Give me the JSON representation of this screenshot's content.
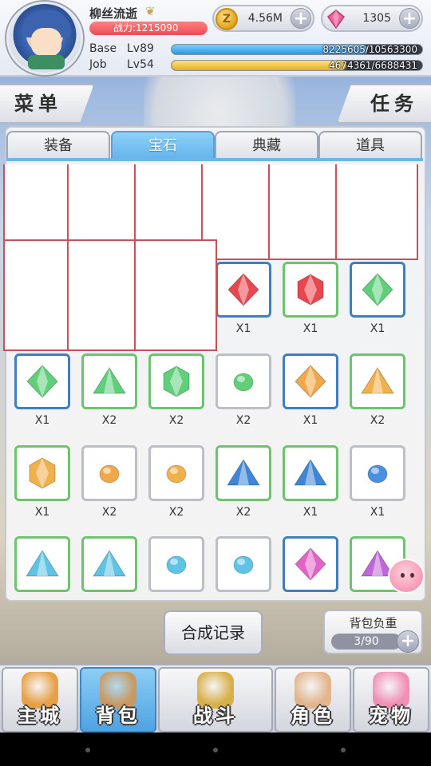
{
  "player": {
    "name": "柳丝流逝",
    "power": "战力:1215090",
    "base_label": "Base",
    "base_level": "Lv89",
    "base_exp": "8225605/10563300",
    "base_progress": 0.779,
    "job_label": "Job",
    "job_level": "Lv54",
    "job_exp": "4674361/6688431",
    "job_progress": 0.699
  },
  "currency": {
    "coin_value": "4.56M",
    "coin_glyph": "Z",
    "gem_value": "1305",
    "plus": "+"
  },
  "side_buttons": {
    "menu": "菜单",
    "task": "任务"
  },
  "tabs": [
    {
      "label": "装备",
      "active": false
    },
    {
      "label": "宝石",
      "active": true
    },
    {
      "label": "典藏",
      "active": false
    },
    {
      "label": "道具",
      "active": false
    }
  ],
  "inventory": {
    "rows": [
      [
        {
          "gem": "diamond",
          "color": "#e8474f",
          "border": "blue",
          "qty": "X1"
        },
        {
          "gem": "hexagon",
          "color": "#e8474f",
          "border": "green",
          "qty": "X1"
        },
        {
          "gem": "diamond",
          "color": "#5fcf7a",
          "border": "blue",
          "qty": "X1"
        }
      ],
      [
        {
          "gem": "diamond",
          "color": "#5fcf7a",
          "border": "blue",
          "qty": "X1"
        },
        {
          "gem": "triangle",
          "color": "#5fcf7a",
          "border": "green",
          "qty": "X2"
        },
        {
          "gem": "hexagon",
          "color": "#5fcf7a",
          "border": "green",
          "qty": "X2"
        },
        {
          "gem": "round",
          "color": "#5fcf7a",
          "border": "gray",
          "qty": "X2"
        },
        {
          "gem": "diamond",
          "color": "#f0a84a",
          "border": "blue",
          "qty": "X1"
        },
        {
          "gem": "triangle",
          "color": "#f0b04a",
          "border": "green",
          "qty": "X2"
        }
      ],
      [
        {
          "gem": "hexagon",
          "color": "#f0b04a",
          "border": "green",
          "qty": "X1"
        },
        {
          "gem": "round",
          "color": "#f0a84a",
          "border": "gray",
          "qty": "X2"
        },
        {
          "gem": "round",
          "color": "#f0b04a",
          "border": "gray",
          "qty": "X2"
        },
        {
          "gem": "triangle",
          "color": "#3f86d6",
          "border": "green",
          "qty": "X2"
        },
        {
          "gem": "triangle",
          "color": "#3f86d6",
          "border": "green",
          "qty": "X1"
        },
        {
          "gem": "round",
          "color": "#4a8fe0",
          "border": "gray",
          "qty": "X1"
        }
      ],
      [
        {
          "gem": "triangle",
          "color": "#5ec4e6",
          "border": "green",
          "qty": ""
        },
        {
          "gem": "triangle",
          "color": "#5ec4e6",
          "border": "green",
          "qty": ""
        },
        {
          "gem": "round",
          "color": "#5ec4e6",
          "border": "gray",
          "qty": ""
        },
        {
          "gem": "round",
          "color": "#5ec4e6",
          "border": "gray",
          "qty": ""
        },
        {
          "gem": "diamond",
          "color": "#e064c8",
          "border": "blue",
          "qty": ""
        },
        {
          "gem": "triangle",
          "color": "#c066d8",
          "border": "green",
          "qty": ""
        }
      ]
    ]
  },
  "synth_button": "合成记录",
  "bag": {
    "label": "背包负重",
    "count": "3/90"
  },
  "nav": [
    {
      "label": "主城",
      "active": false,
      "color": "#e7a044"
    },
    {
      "label": "背包",
      "active": true,
      "color": "#c89a62"
    },
    {
      "label": "战斗",
      "active": false,
      "color": "#d9b048"
    },
    {
      "label": "角色",
      "active": false,
      "color": "#e2b58c"
    },
    {
      "label": "宠物",
      "active": false,
      "color": "#f190b6"
    }
  ]
}
